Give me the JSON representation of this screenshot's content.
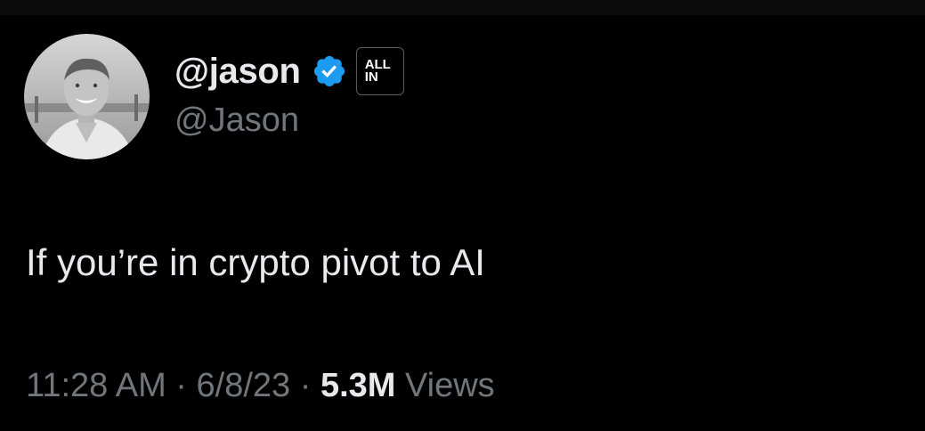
{
  "author": {
    "display_name": "@jason",
    "handle": "@Jason",
    "verified_icon": "verified-badge-icon",
    "affiliate_badge": {
      "line1": "ALL",
      "line2": "IN"
    },
    "avatar": "profile-photo"
  },
  "tweet": {
    "text": "If you’re in crypto pivot to AI"
  },
  "meta": {
    "time": "11:28 AM",
    "separator_1": " · ",
    "date": "6/8/23",
    "separator_2": " · ",
    "views_count": "5.3M",
    "views_label": " Views"
  },
  "colors": {
    "background": "#000000",
    "primary_text": "#e7e9ea",
    "secondary_text": "#71767b",
    "verified_blue": "#1d9bf0"
  }
}
